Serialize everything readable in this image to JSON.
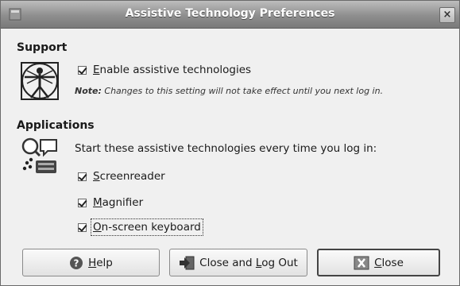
{
  "window": {
    "title": "Assistive Technology Preferences",
    "close_glyph": "×"
  },
  "support": {
    "heading": "Support",
    "enable_label_mnemonic": "E",
    "enable_label_rest": "nable assistive technologies",
    "note_bold": "Note:",
    "note_text": " Changes to this setting will not take effect until you next log in.",
    "icon": "vitruvian-man-icon"
  },
  "applications": {
    "heading": "Applications",
    "intro": "Start these assistive technologies every time you log in:",
    "icon": "assistive-apps-icon",
    "items": [
      {
        "mnemonic": "S",
        "rest": "creenreader",
        "checked": true
      },
      {
        "mnemonic": "M",
        "rest": "agnifier",
        "checked": true
      },
      {
        "mnemonic": "O",
        "rest": "n-screen keyboard",
        "checked": true
      }
    ]
  },
  "buttons": {
    "help": {
      "mnemonic": "H",
      "rest": "elp",
      "icon": "help-icon"
    },
    "logout": {
      "before": "Close and ",
      "mnemonic": "L",
      "after": "og Out",
      "icon": "logout-icon"
    },
    "close": {
      "mnemonic": "C",
      "rest": "lose",
      "icon": "close-icon"
    }
  }
}
